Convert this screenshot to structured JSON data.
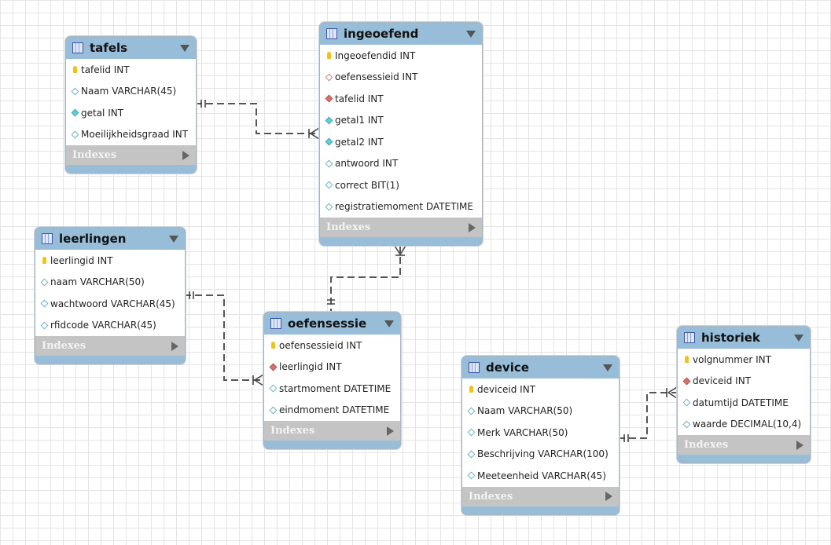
{
  "diagram": {
    "indexes_label": "Indexes",
    "tables": [
      {
        "name": "tafels",
        "columns": [
          {
            "text": "tafelid INT",
            "icon": "primary-key"
          },
          {
            "text": "Naam VARCHAR(45)",
            "icon": "column"
          },
          {
            "text": "getal INT",
            "icon": "not-null-column"
          },
          {
            "text": "Moeilijkheidsgraad INT",
            "icon": "column"
          }
        ]
      },
      {
        "name": "ingeoefend",
        "columns": [
          {
            "text": "Ingeoefendid INT",
            "icon": "primary-key"
          },
          {
            "text": "oefensessieid INT",
            "icon": "foreign-key-nullable"
          },
          {
            "text": "tafelid INT",
            "icon": "foreign-key"
          },
          {
            "text": "getal1 INT",
            "icon": "not-null-column"
          },
          {
            "text": "getal2 INT",
            "icon": "not-null-column"
          },
          {
            "text": "antwoord INT",
            "icon": "column"
          },
          {
            "text": "correct BIT(1)",
            "icon": "column"
          },
          {
            "text": "registratiemoment DATETIME",
            "icon": "column"
          }
        ]
      },
      {
        "name": "leerlingen",
        "columns": [
          {
            "text": "leerlingid INT",
            "icon": "primary-key"
          },
          {
            "text": "naam VARCHAR(50)",
            "icon": "column"
          },
          {
            "text": "wachtwoord VARCHAR(45)",
            "icon": "column"
          },
          {
            "text": "rfidcode VARCHAR(45)",
            "icon": "column"
          }
        ]
      },
      {
        "name": "oefensessie",
        "columns": [
          {
            "text": "oefensessieid INT",
            "icon": "primary-key"
          },
          {
            "text": "leerlingid INT",
            "icon": "foreign-key"
          },
          {
            "text": "startmoment DATETIME",
            "icon": "column"
          },
          {
            "text": "eindmoment DATETIME",
            "icon": "column"
          }
        ]
      },
      {
        "name": "device",
        "columns": [
          {
            "text": "deviceid INT",
            "icon": "primary-key"
          },
          {
            "text": "Naam VARCHAR(50)",
            "icon": "column"
          },
          {
            "text": "Merk VARCHAR(50)",
            "icon": "column"
          },
          {
            "text": "Beschrijving VARCHAR(100)",
            "icon": "column"
          },
          {
            "text": "Meeteenheid VARCHAR(45)",
            "icon": "column"
          }
        ]
      },
      {
        "name": "historiek",
        "columns": [
          {
            "text": "volgnummer INT",
            "icon": "primary-key"
          },
          {
            "text": "deviceid INT",
            "icon": "foreign-key"
          },
          {
            "text": "datumtijd DATETIME",
            "icon": "column"
          },
          {
            "text": "waarde DECIMAL(10,4)",
            "icon": "column"
          }
        ]
      }
    ],
    "relationships": [
      {
        "from": "tafels",
        "to": "ingeoefend",
        "cardinality": "one-to-many"
      },
      {
        "from": "oefensessie",
        "to": "ingeoefend",
        "cardinality": "one-to-many"
      },
      {
        "from": "leerlingen",
        "to": "oefensessie",
        "cardinality": "one-to-many"
      },
      {
        "from": "device",
        "to": "historiek",
        "cardinality": "one-to-many"
      }
    ]
  }
}
